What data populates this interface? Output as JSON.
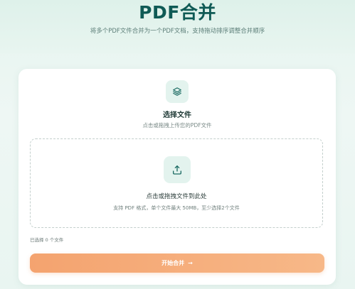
{
  "header": {
    "title": "PDF合并",
    "subtitle": "将多个PDF文件合并为一个PDF文档，支持拖动排序调整合并顺序"
  },
  "select": {
    "title": "选择文件",
    "subtitle": "点击或拖拽上传您的PDF文件",
    "icon": "layers-icon"
  },
  "dropzone": {
    "title": "点击或拖拽文件到此处",
    "hint": "支持 PDF 格式，单个文件最大 50MB，至少选择2个文件",
    "icon": "upload-icon"
  },
  "status": {
    "selected_count": "已选择 0 个文件"
  },
  "actions": {
    "merge_label": "开始合并",
    "merge_arrow": "→"
  },
  "colors": {
    "accent": "#0f5a55",
    "button": "#f4a36f",
    "tile": "#e3f3ee"
  }
}
